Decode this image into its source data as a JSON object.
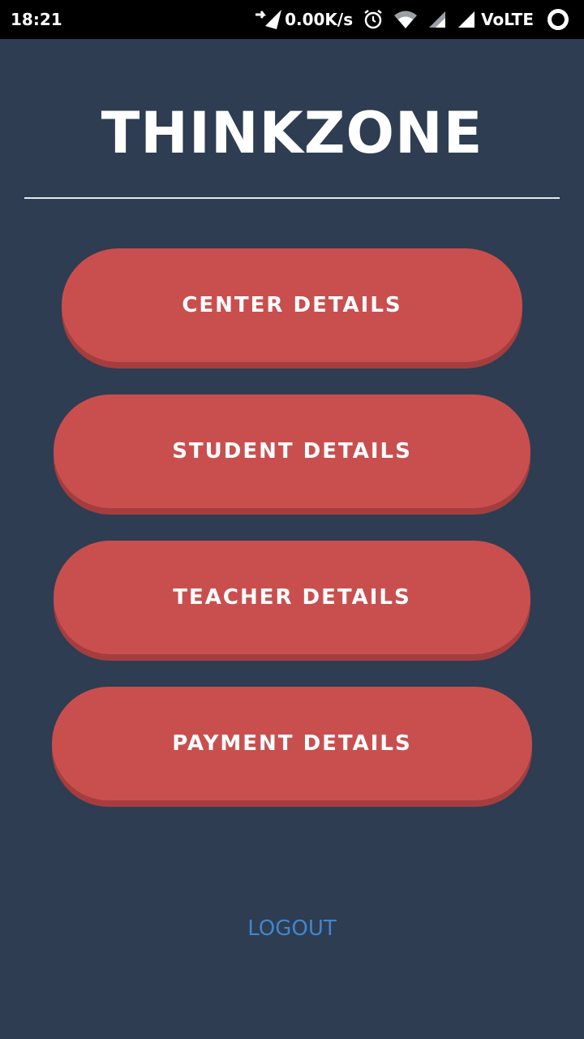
{
  "status_bar": {
    "time": "18:21",
    "net_speed": "0.00K/s",
    "network_label": "VoLTE",
    "icons": [
      "data-transfer-icon",
      "alarm-icon",
      "wifi-icon",
      "signal-icon",
      "signal-icon",
      "sync-circle-icon"
    ]
  },
  "header": {
    "title": "THINKZONE"
  },
  "menu": {
    "center_details": "CENTER DETAILS",
    "student_details": "STUDENT DETAILS",
    "teacher_details": "TEACHER DETAILS",
    "payment_details": "PAYMENT DETAILS"
  },
  "footer": {
    "logout": "LOGOUT"
  },
  "colors": {
    "background": "#2e3d51",
    "button": "#c94f4f",
    "button_shadow": "#a53d3e",
    "logout_link": "#3f86cf"
  }
}
